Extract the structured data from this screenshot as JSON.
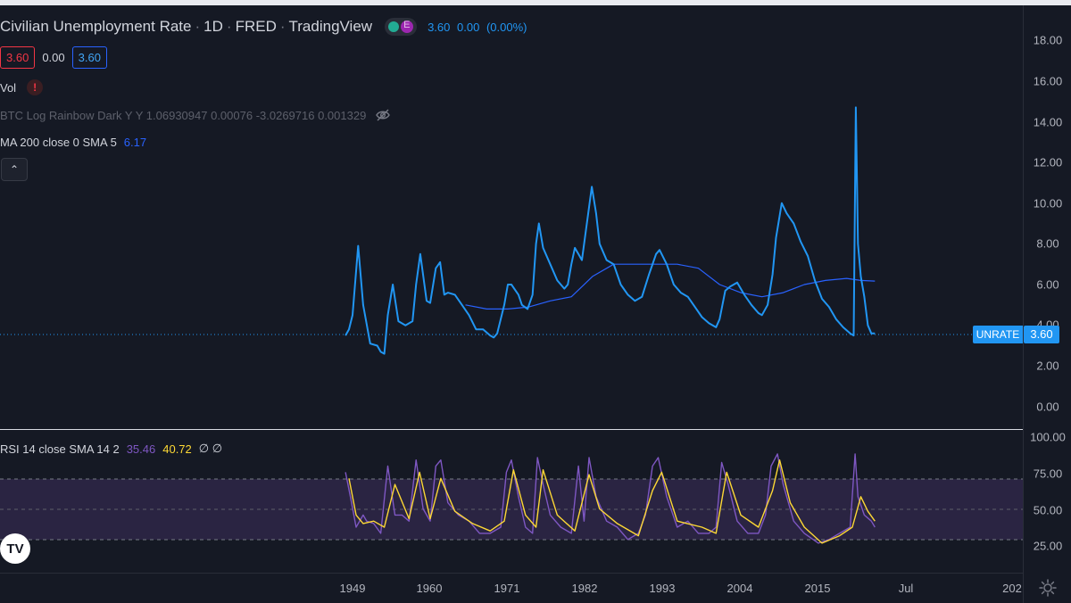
{
  "header": {
    "symbol_name": "Civilian Unemployment Rate",
    "interval": "1D",
    "source": "FRED",
    "platform": "TradingView",
    "last_value": "3.60",
    "change": "0.00",
    "change_pct": "(0.00%)",
    "sep": "·"
  },
  "price_boxes": {
    "bid": "3.60",
    "spread": "0.00",
    "ask": "3.60"
  },
  "indicators": {
    "vol_label": "Vol",
    "vol_warning": "!",
    "btc_rainbow": "BTC Log Rainbow Dark Y Y 1.06930947 0.00076 -3.0269716 0.001329",
    "ma_label": "MA 200 close 0 SMA 5",
    "ma_value": "6.17",
    "collapse_symbol": "⌃",
    "rsi_label": "RSI 14 close SMA 14 2",
    "rsi_value": "35.46",
    "rsi_ma_value": "40.72",
    "rsi_extra": "∅ ∅"
  },
  "price_scale": [
    "18.00",
    "16.00",
    "14.00",
    "12.00",
    "10.00",
    "8.00",
    "6.00",
    "4.00",
    "2.00",
    "0.00"
  ],
  "rsi_scale": [
    "100.00",
    "75.00",
    "50.00",
    "25.00"
  ],
  "time_scale": [
    "1949",
    "1960",
    "1971",
    "1982",
    "1993",
    "2004",
    "2015",
    "Jul",
    "202"
  ],
  "series_label": "UNRATE",
  "last_price_label": "3.60",
  "logo_text": "TV",
  "colors": {
    "background": "#151924",
    "price_line": "#2196f3",
    "ma_line": "#2962ff",
    "rsi_line": "#7e57c2",
    "rsi_ma_line": "#fdd835",
    "rsi_band": "#2a2442"
  },
  "chart_data": [
    {
      "type": "line",
      "title": "Civilian Unemployment Rate",
      "ylim": [
        0,
        18
      ],
      "series": [
        {
          "name": "UNRATE",
          "x": [
            1948.0,
            1948.5,
            1949.0,
            1949.8,
            1950.5,
            1951.5,
            1952.5,
            1953.0,
            1953.5,
            1954.0,
            1954.7,
            1955.5,
            1956.5,
            1957.5,
            1958.0,
            1958.6,
            1959.5,
            1960.0,
            1960.8,
            1961.4,
            1962.0,
            1962.5,
            1963.5,
            1964.5,
            1965.5,
            1966.5,
            1967.5,
            1968.5,
            1969.0,
            1969.5,
            1970.5,
            1971.0,
            1971.5,
            1972.5,
            1973.0,
            1973.8,
            1974.5,
            1975.0,
            1975.4,
            1976.0,
            1977.0,
            1978.0,
            1979.0,
            1979.5,
            1980.0,
            1980.5,
            1981.0,
            1981.5,
            1982.0,
            1982.9,
            1983.5,
            1984.0,
            1985.0,
            1986.0,
            1987.0,
            1988.0,
            1989.0,
            1990.0,
            1991.0,
            1992.0,
            1992.5,
            1993.5,
            1994.5,
            1995.5,
            1996.5,
            1997.5,
            1998.5,
            1999.5,
            2000.5,
            2001.0,
            2001.8,
            2002.5,
            2003.5,
            2004.5,
            2005.5,
            2006.5,
            2007.0,
            2007.8,
            2008.5,
            2009.0,
            2009.8,
            2010.5,
            2011.5,
            2012.5,
            2013.5,
            2014.5,
            2015.5,
            2016.5,
            2017.5,
            2018.5,
            2019.5,
            2020.0,
            2020.3,
            2020.6,
            2021.0,
            2021.5,
            2022.0,
            2022.5,
            2023.0
          ],
          "values": [
            3.5,
            3.8,
            4.5,
            7.9,
            5.0,
            3.1,
            3.0,
            2.7,
            2.6,
            4.5,
            6.0,
            4.2,
            4.0,
            4.2,
            6.0,
            7.5,
            5.2,
            5.1,
            6.8,
            7.1,
            5.5,
            5.6,
            5.5,
            5.0,
            4.5,
            3.8,
            3.8,
            3.5,
            3.4,
            3.6,
            5.0,
            6.0,
            6.0,
            5.5,
            5.0,
            4.8,
            5.5,
            8.0,
            9.0,
            7.8,
            7.0,
            6.2,
            5.8,
            6.0,
            7.0,
            7.8,
            7.5,
            7.2,
            8.5,
            10.8,
            9.5,
            8.0,
            7.2,
            7.0,
            6.0,
            5.5,
            5.2,
            5.4,
            6.5,
            7.5,
            7.7,
            7.0,
            6.0,
            5.6,
            5.4,
            4.9,
            4.4,
            4.1,
            3.9,
            4.3,
            5.7,
            5.9,
            6.1,
            5.5,
            5.0,
            4.6,
            4.5,
            5.0,
            6.5,
            8.3,
            10.0,
            9.5,
            9.0,
            8.1,
            7.4,
            6.2,
            5.3,
            4.9,
            4.3,
            3.9,
            3.6,
            3.5,
            14.7,
            8.0,
            6.4,
            5.4,
            4.0,
            3.6,
            3.6
          ]
        },
        {
          "name": "MA 200",
          "x": [
            1965.0,
            1968.0,
            1971.0,
            1974.0,
            1977.0,
            1980.0,
            1983.0,
            1986.0,
            1989.0,
            1992.0,
            1995.0,
            1998.0,
            2001.0,
            2004.0,
            2007.0,
            2010.0,
            2013.0,
            2016.0,
            2019.0,
            2021.0,
            2023.0
          ],
          "values": [
            5.0,
            4.8,
            4.8,
            4.9,
            5.2,
            5.4,
            6.4,
            7.0,
            7.0,
            7.0,
            7.0,
            6.8,
            6.0,
            5.6,
            5.4,
            5.6,
            6.0,
            6.2,
            6.3,
            6.2,
            6.17
          ]
        }
      ]
    },
    {
      "type": "line",
      "title": "RSI 14 close SMA 14 2",
      "ylim": [
        0,
        100
      ],
      "bands": [
        30,
        50,
        70
      ],
      "series": [
        {
          "name": "RSI",
          "x": [
            1948.0,
            1948.7,
            1949.5,
            1950.5,
            1951.0,
            1952.0,
            1953.0,
            1954.0,
            1955.0,
            1956.0,
            1957.0,
            1958.0,
            1959.0,
            1960.0,
            1960.8,
            1961.5,
            1962.5,
            1964.0,
            1965.5,
            1967.0,
            1968.5,
            1970.0,
            1970.8,
            1971.5,
            1972.5,
            1973.5,
            1974.5,
            1975.2,
            1976.0,
            1977.0,
            1978.5,
            1980.0,
            1981.0,
            1981.8,
            1982.5,
            1983.5,
            1985.0,
            1986.5,
            1988.0,
            1989.5,
            1990.5,
            1991.5,
            1992.3,
            1993.5,
            1995.0,
            1996.5,
            1998.0,
            1999.5,
            2000.5,
            2001.3,
            2002.2,
            2003.5,
            2005.0,
            2006.5,
            2007.5,
            2008.3,
            2009.2,
            2010.0,
            2011.5,
            2013.0,
            2015.0,
            2016.5,
            2018.0,
            2019.5,
            2020.2,
            2020.6,
            2021.5,
            2022.5,
            2023.0
          ],
          "values": [
            80,
            60,
            35,
            45,
            40,
            38,
            30,
            85,
            45,
            45,
            40,
            90,
            50,
            40,
            85,
            90,
            55,
            45,
            40,
            30,
            30,
            35,
            80,
            90,
            60,
            35,
            30,
            92,
            70,
            45,
            35,
            30,
            85,
            40,
            92,
            60,
            40,
            35,
            25,
            30,
            45,
            85,
            92,
            60,
            35,
            40,
            30,
            30,
            35,
            88,
            70,
            40,
            30,
            30,
            45,
            85,
            95,
            70,
            40,
            30,
            22,
            25,
            30,
            35,
            95,
            60,
            45,
            40,
            35
          ]
        },
        {
          "name": "SMA 14",
          "x": [
            1948.5,
            1949.5,
            1950.5,
            1952.0,
            1953.5,
            1955.0,
            1957.0,
            1958.5,
            1960.0,
            1961.5,
            1963.5,
            1966.0,
            1968.5,
            1970.5,
            1971.8,
            1973.5,
            1975.0,
            1976.0,
            1978.0,
            1980.5,
            1982.5,
            1984.0,
            1986.5,
            1989.5,
            1991.5,
            1992.8,
            1995.0,
            1998.5,
            2000.5,
            2002.0,
            2004.0,
            2006.5,
            2008.5,
            2009.5,
            2011.0,
            2013.0,
            2015.5,
            2018.0,
            2019.8,
            2021.0,
            2022.0,
            2023.0
          ],
          "values": [
            75,
            45,
            38,
            40,
            35,
            70,
            42,
            80,
            42,
            75,
            48,
            38,
            32,
            40,
            82,
            45,
            35,
            82,
            45,
            32,
            78,
            50,
            38,
            28,
            65,
            80,
            40,
            35,
            30,
            80,
            45,
            35,
            65,
            90,
            55,
            35,
            22,
            28,
            35,
            60,
            48,
            40
          ]
        }
      ]
    }
  ]
}
